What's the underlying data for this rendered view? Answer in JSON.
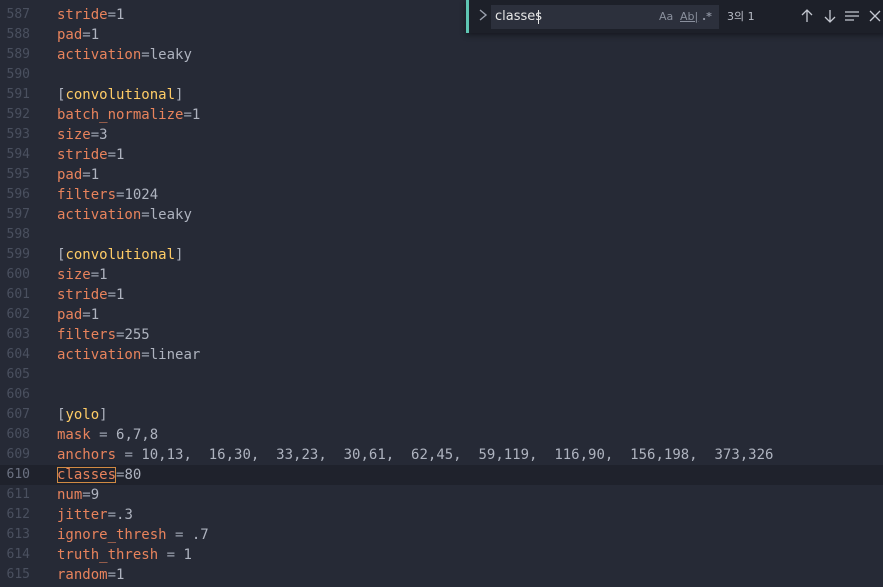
{
  "editor": {
    "lines": [
      {
        "n": "587",
        "t": "kv",
        "k": "stride",
        "eq": "=",
        "v": "1"
      },
      {
        "n": "588",
        "t": "kv",
        "k": "pad",
        "eq": "=",
        "v": "1"
      },
      {
        "n": "589",
        "t": "kv",
        "k": "activation",
        "eq": "=",
        "v": "leaky"
      },
      {
        "n": "590",
        "t": "blank"
      },
      {
        "n": "591",
        "t": "sec",
        "s": "convolutional"
      },
      {
        "n": "592",
        "t": "kv",
        "k": "batch_normalize",
        "eq": "=",
        "v": "1"
      },
      {
        "n": "593",
        "t": "kv",
        "k": "size",
        "eq": "=",
        "v": "3"
      },
      {
        "n": "594",
        "t": "kv",
        "k": "stride",
        "eq": "=",
        "v": "1"
      },
      {
        "n": "595",
        "t": "kv",
        "k": "pad",
        "eq": "=",
        "v": "1"
      },
      {
        "n": "596",
        "t": "kv",
        "k": "filters",
        "eq": "=",
        "v": "1024"
      },
      {
        "n": "597",
        "t": "kv",
        "k": "activation",
        "eq": "=",
        "v": "leaky"
      },
      {
        "n": "598",
        "t": "blank"
      },
      {
        "n": "599",
        "t": "sec",
        "s": "convolutional"
      },
      {
        "n": "600",
        "t": "kv",
        "k": "size",
        "eq": "=",
        "v": "1"
      },
      {
        "n": "601",
        "t": "kv",
        "k": "stride",
        "eq": "=",
        "v": "1"
      },
      {
        "n": "602",
        "t": "kv",
        "k": "pad",
        "eq": "=",
        "v": "1"
      },
      {
        "n": "603",
        "t": "kv",
        "k": "filters",
        "eq": "=",
        "v": "255"
      },
      {
        "n": "604",
        "t": "kv",
        "k": "activation",
        "eq": "=",
        "v": "linear"
      },
      {
        "n": "605",
        "t": "blank"
      },
      {
        "n": "606",
        "t": "blank"
      },
      {
        "n": "607",
        "t": "sec",
        "s": "yolo"
      },
      {
        "n": "608",
        "t": "kv",
        "k": "mask",
        "eq": " = ",
        "v": "6,7,8"
      },
      {
        "n": "609",
        "t": "kv",
        "k": "anchors",
        "eq": " = ",
        "v": "10,13,  16,30,  33,23,  30,61,  62,45,  59,119,  116,90,  156,198,  373,326"
      },
      {
        "n": "610",
        "t": "kv",
        "k": "classes",
        "eq": "=",
        "v": "80",
        "current": true,
        "match": true
      },
      {
        "n": "611",
        "t": "kv",
        "k": "num",
        "eq": "=",
        "v": "9"
      },
      {
        "n": "612",
        "t": "kv",
        "k": "jitter",
        "eq": "=",
        "v": ".3"
      },
      {
        "n": "613",
        "t": "kv",
        "k": "ignore_thresh",
        "eq": " = ",
        "v": ".7"
      },
      {
        "n": "614",
        "t": "kv",
        "k": "truth_thresh",
        "eq": " = ",
        "v": "1"
      },
      {
        "n": "615",
        "t": "kv",
        "k": "random",
        "eq": "=",
        "v": "1"
      }
    ]
  },
  "find_widget": {
    "query": "classes",
    "match_case_label": "Aa",
    "whole_word_label": "Ab|",
    "regex_label": ".*",
    "result_count": "3의 1",
    "accent_color": "#5fc6b3",
    "icons": [
      "chevron-right-icon",
      "arrow-up-icon",
      "arrow-down-icon",
      "selection-icon",
      "close-icon"
    ]
  },
  "colors": {
    "background": "#262a36",
    "key": "#e8835c",
    "section": "#ffcc66",
    "value": "#aeb3bf"
  }
}
